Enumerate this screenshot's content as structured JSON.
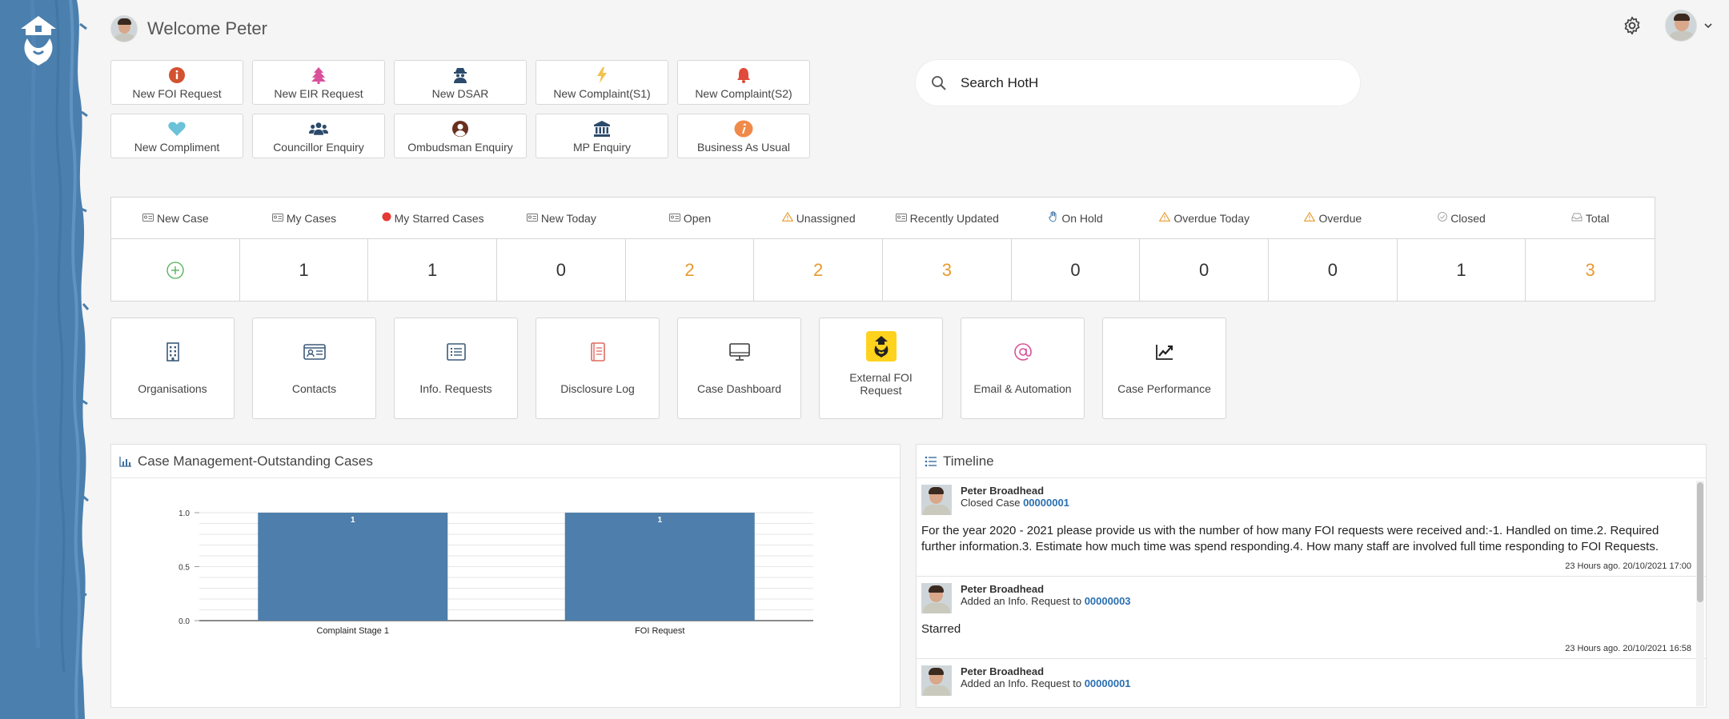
{
  "header": {
    "welcome": "Welcome Peter"
  },
  "quick_actions": [
    {
      "label": "New FOI Request",
      "icon": "info-circle-icon",
      "color": "#d35230"
    },
    {
      "label": "New EIR Request",
      "icon": "tree-icon",
      "color": "#d9519a"
    },
    {
      "label": "New DSAR",
      "icon": "user-secret-icon",
      "color": "#2c4a6b"
    },
    {
      "label": "New Complaint(S1)",
      "icon": "bolt-icon",
      "color": "#f2c14e"
    },
    {
      "label": "New Complaint(S2)",
      "icon": "bell-icon",
      "color": "#e04b3c"
    },
    {
      "label": "New Compliment",
      "icon": "heart-icon",
      "color": "#6cc2d8"
    },
    {
      "label": "Councillor Enquiry",
      "icon": "users-icon",
      "color": "#2c4a6b"
    },
    {
      "label": "Ombudsman Enquiry",
      "icon": "user-circle-icon",
      "color": "#6b2f1f"
    },
    {
      "label": "MP Enquiry",
      "icon": "bank-icon",
      "color": "#2c4a6b"
    },
    {
      "label": "Business As Usual",
      "icon": "info-badge-icon",
      "color": "#f08a4b"
    }
  ],
  "search": {
    "placeholder": "Search HotH"
  },
  "stats": {
    "headers": [
      {
        "label": "New Case",
        "icon": "id-card-icon"
      },
      {
        "label": "My Cases",
        "icon": "id-card-icon"
      },
      {
        "label": "My Starred Cases",
        "icon": "red-dot-icon"
      },
      {
        "label": "New Today",
        "icon": "id-card-icon"
      },
      {
        "label": "Open",
        "icon": "id-card-icon"
      },
      {
        "label": "Unassigned",
        "icon": "warning-icon"
      },
      {
        "label": "Recently Updated",
        "icon": "id-card-icon"
      },
      {
        "label": "On Hold",
        "icon": "hand-icon"
      },
      {
        "label": "Overdue Today",
        "icon": "warning-icon"
      },
      {
        "label": "Overdue",
        "icon": "warning-icon"
      },
      {
        "label": "Closed",
        "icon": "check-circle-icon"
      },
      {
        "label": "Total",
        "icon": "inbox-icon"
      }
    ],
    "values": [
      "",
      "1",
      "1",
      "0",
      "2",
      "2",
      "3",
      "0",
      "0",
      "0",
      "1",
      "3"
    ],
    "orange_color": "#e79a2e",
    "add_color": "#4caf50"
  },
  "modules": [
    {
      "label": "Organisations",
      "icon": "building-icon"
    },
    {
      "label": "Contacts",
      "icon": "contact-card-icon"
    },
    {
      "label": "Info. Requests",
      "icon": "list-icon"
    },
    {
      "label": "Disclosure Log",
      "icon": "book-icon"
    },
    {
      "label": "Case Dashboard",
      "icon": "monitor-icon"
    },
    {
      "label": "External FOI Request",
      "icon": "hoth-logo-icon"
    },
    {
      "label": "Email & Automation",
      "icon": "at-icon"
    },
    {
      "label": "Case Performance",
      "icon": "line-chart-icon"
    }
  ],
  "chart_panel": {
    "title": "Case Management-Outstanding Cases"
  },
  "chart_data": {
    "type": "bar",
    "categories": [
      "Complaint Stage 1",
      "FOI Request"
    ],
    "values": [
      1,
      1
    ],
    "data_labels": [
      "1",
      "1"
    ],
    "yticks": [
      "0.0",
      "0.5",
      "1.0"
    ],
    "ylim": [
      0,
      1
    ],
    "grid": true,
    "bar_color": "#4e7eab"
  },
  "timeline": {
    "title": "Timeline",
    "items": [
      {
        "name": "Peter Broadhead",
        "action": "Closed Case",
        "ref": "00000001",
        "body": "For the year 2020 - 2021 please provide us with the number of how many FOI requests were received and:-1. Handled on time.2. Required further information.3. Estimate how much time was spend responding.4. How many staff are involved full time responding to FOI Requests.",
        "time": "23 Hours ago. 20/10/2021 17:00"
      },
      {
        "name": "Peter Broadhead",
        "action": "Added an Info. Request to",
        "ref": "00000003",
        "body": "Starred",
        "time": "23 Hours ago. 20/10/2021 16:58"
      },
      {
        "name": "Peter Broadhead",
        "action": "Added an Info. Request to",
        "ref": "00000001",
        "body": "",
        "time": ""
      }
    ]
  },
  "colors": {
    "sidebar_blue": "#4a7fae",
    "link_blue": "#2a6fb0"
  }
}
